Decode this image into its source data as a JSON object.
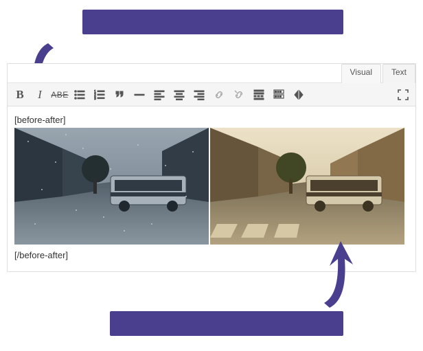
{
  "callouts": {
    "top": "",
    "bottom": ""
  },
  "tabs": {
    "visual": "Visual",
    "text": "Text",
    "active": "visual"
  },
  "toolbar": {
    "bold": "B",
    "italic": "I",
    "strike": "ABE"
  },
  "shortcode": {
    "open": "[before-after]",
    "close": "[/before-after]"
  }
}
